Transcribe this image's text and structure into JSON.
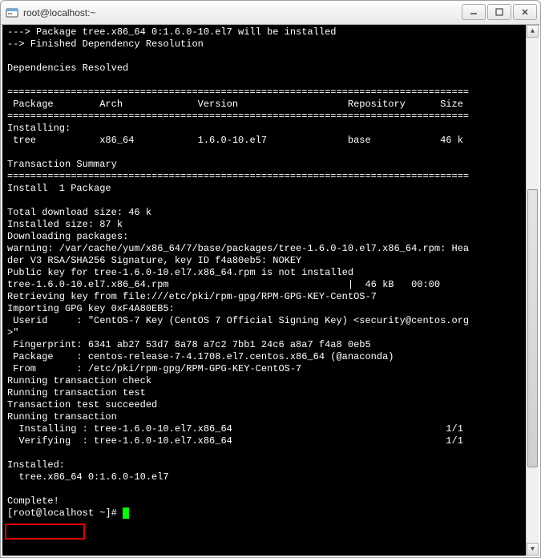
{
  "window": {
    "title": "root@localhost:~"
  },
  "term": {
    "l01": "---> Package tree.x86_64 0:1.6.0-10.el7 will be installed",
    "l02": "--> Finished Dependency Resolution",
    "l03": "",
    "l04": "Dependencies Resolved",
    "l05": "",
    "l06": "================================================================================",
    "l07": " Package        Arch             Version                   Repository      Size",
    "l08": "================================================================================",
    "l09": "Installing:",
    "l10": " tree           x86_64           1.6.0-10.el7              base            46 k",
    "l11": "",
    "l12": "Transaction Summary",
    "l13": "================================================================================",
    "l14": "Install  1 Package",
    "l15": "",
    "l16": "Total download size: 46 k",
    "l17": "Installed size: 87 k",
    "l18": "Downloading packages:",
    "l19": "warning: /var/cache/yum/x86_64/7/base/packages/tree-1.6.0-10.el7.x86_64.rpm: Hea",
    "l20": "der V3 RSA/SHA256 Signature, key ID f4a80eb5: NOKEY",
    "l21": "Public key for tree-1.6.0-10.el7.x86_64.rpm is not installed",
    "l22": "tree-1.6.0-10.el7.x86_64.rpm                               |  46 kB   00:00",
    "l23": "Retrieving key from file:///etc/pki/rpm-gpg/RPM-GPG-KEY-CentOS-7",
    "l24": "Importing GPG key 0xF4A80EB5:",
    "l25": " Userid     : \"CentOS-7 Key (CentOS 7 Official Signing Key) <security@centos.org",
    "l26": ">\"",
    "l27": " Fingerprint: 6341 ab27 53d7 8a78 a7c2 7bb1 24c6 a8a7 f4a8 0eb5",
    "l28": " Package    : centos-release-7-4.1708.el7.centos.x86_64 (@anaconda)",
    "l29": " From       : /etc/pki/rpm-gpg/RPM-GPG-KEY-CentOS-7",
    "l30": "Running transaction check",
    "l31": "Running transaction test",
    "l32": "Transaction test succeeded",
    "l33": "Running transaction",
    "l34": "  Installing : tree-1.6.0-10.el7.x86_64                                     1/1",
    "l35": "  Verifying  : tree-1.6.0-10.el7.x86_64                                     1/1",
    "l36": "",
    "l37": "Installed:",
    "l38": "  tree.x86_64 0:1.6.0-10.el7",
    "l39": "",
    "l40": "Complete!",
    "l41": "[root@localhost ~]# "
  }
}
